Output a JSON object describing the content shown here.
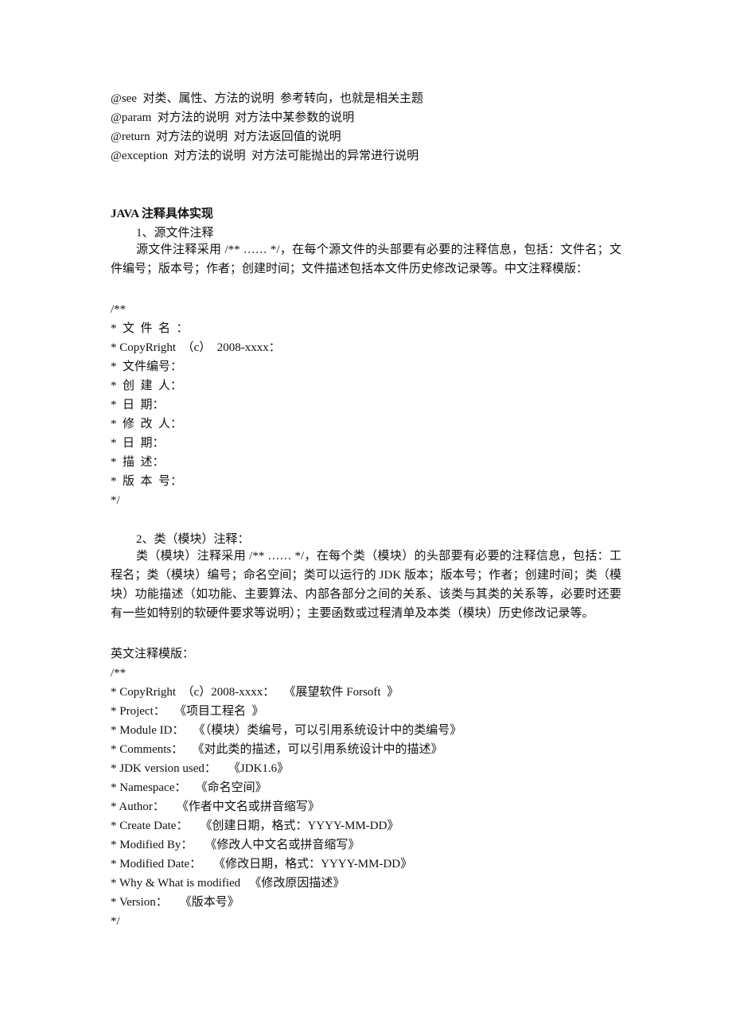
{
  "tags": [
    "@see  对类、属性、方法的说明  参考转向，也就是相关主题",
    "@param  对方法的说明  对方法中某参数的说明",
    "@return  对方法的说明  对方法返回值的说明",
    "@exception  对方法的说明  对方法可能抛出的异常进行说明"
  ],
  "section_title": "JAVA 注释具体实现",
  "source_file": {
    "heading": "1、源文件注释",
    "paragraph": "源文件注释采用  /** …… */，在每个源文件的头部要有必要的注释信息，包括：文件名；文件编号；版本号；作者；创建时间；文件描述包括本文件历史修改记录等。中文注释模版：",
    "template": [
      "/**",
      "*  文  件  名  ：",
      "* CopyRright  （c）  2008-xxxx：",
      "*  文件编号：",
      "*  创  建  人：",
      "*  日  期：",
      "*  修  改  人：",
      "*  日  期：",
      "*  描  述：",
      "*  版  本  号：",
      "*/"
    ]
  },
  "class_module": {
    "heading": "2、类（模块）注释：",
    "paragraph": "类（模块）注释采用  /** …… */，在每个类（模块）的头部要有必要的注释信息，包括：工程名；类（模块）编号；命名空间；类可以运行的 JDK 版本；版本号；作者；创建时间；类（模块）功能描述（如功能、主要算法、内部各部分之间的关系、该类与其类的关系等，必要时还要有一些如特别的软硬件要求等说明）；主要函数或过程清单及本类（模块）历史修改记录等。",
    "template_label": "英文注释模版：",
    "template": [
      "/**",
      "* CopyRright  （c）2008-xxxx：   《展望软件 Forsoft  》",
      "* Project：   《项目工程名  》",
      "* Module ID：   《（模块）类编号，可以引用系统设计中的类编号》",
      "* Comments：   《对此类的描述，可以引用系统设计中的描述》",
      "* JDK version used：    《JDK1.6》",
      "* Namespace：   《命名空间》",
      "* Author：    《作者中文名或拼音缩写》",
      "* Create Date：    《创建日期，格式：YYYY-MM-DD》",
      "* Modified By：    《修改人中文名或拼音缩写》",
      "* Modified Date：    《修改日期，格式：YYYY-MM-DD》",
      "* Why & What is modified   《修改原因描述》",
      "* Version：    《版本号》",
      "*/"
    ]
  }
}
